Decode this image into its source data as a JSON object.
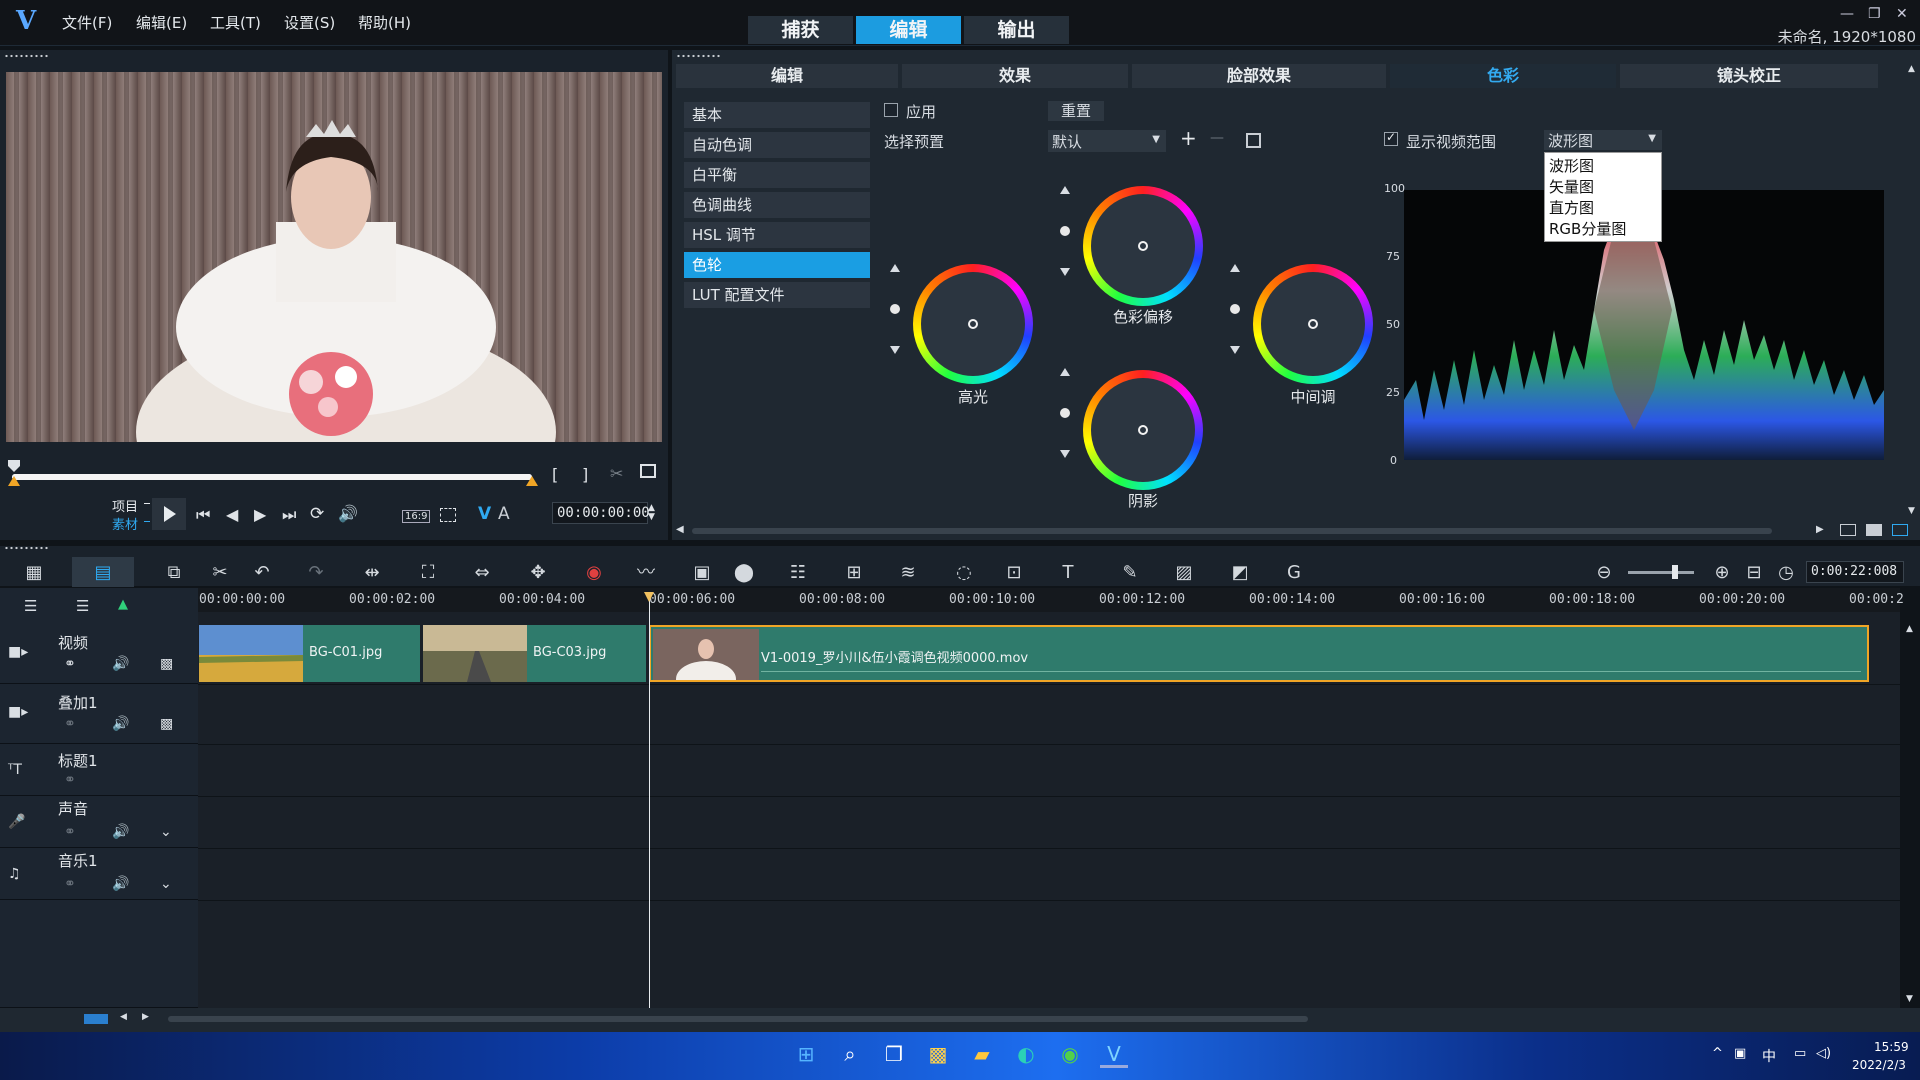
{
  "app": {
    "logo_letter": "V",
    "menu": [
      "文件(F)",
      "编辑(E)",
      "工具(T)",
      "设置(S)",
      "帮助(H)"
    ],
    "modes": [
      "捕获",
      "编辑",
      "输出"
    ],
    "active_mode": 1,
    "project_info": "未命名, 1920*1080",
    "window_controls": [
      "—",
      "❐",
      "✕"
    ]
  },
  "preview": {
    "mode_project": "项目",
    "mode_clip": "素材",
    "aspect": "16:9",
    "v_label": "V",
    "a_label": "A",
    "timecode": "00:00:00:00",
    "scrub_progress": 1.0
  },
  "options_panel": {
    "tabs": [
      "编辑",
      "效果",
      "脸部效果",
      "色彩",
      "镜头校正"
    ],
    "active_tab": 3,
    "categories": [
      "基本",
      "自动色调",
      "白平衡",
      "色调曲线",
      "HSL 调节",
      "色轮",
      "LUT 配置文件"
    ],
    "active_category": 5,
    "apply_label": "应用",
    "reset_label": "重置",
    "preset_label": "选择预置",
    "preset_value": "默认",
    "add_symbol": "+",
    "remove_symbol": "—",
    "wheels": {
      "highlight": "高光",
      "offset": "色彩偏移",
      "midtone": "中间调",
      "shadow": "阴影"
    },
    "scope": {
      "show_label": "显示视频范围",
      "show_checked": true,
      "selected": "波形图",
      "options": [
        "波形图",
        "矢量图",
        "直方图",
        "RGB分量图"
      ],
      "ticks": [
        "100",
        "75",
        "50",
        "25",
        "0"
      ]
    }
  },
  "timeline": {
    "current_time": "0:00:22:008",
    "ruler": [
      "00:00:00:00",
      "00:00:02:00",
      "00:00:04:00",
      "00:00:06:00",
      "00:00:08:00",
      "00:00:10:00",
      "00:00:12:00",
      "00:00:14:00",
      "00:00:16:00",
      "00:00:18:00",
      "00:00:20:00",
      "00:00:2"
    ],
    "tracks": [
      "视频",
      "叠加1",
      "标题1",
      "声音",
      "音乐1"
    ],
    "clips": [
      {
        "name": "BG-C01.jpg"
      },
      {
        "name": "BG-C03.jpg"
      },
      {
        "name": "V1-0019_罗小川&伍小霞调色视频0000.mov"
      }
    ]
  },
  "taskbar": {
    "ime": "中",
    "time": "15:59",
    "date": "2022/2/3"
  },
  "colors": {
    "accent": "#1c9ce0",
    "clip": "#2f7b6c",
    "panel": "#1e2630",
    "background": "#0f1419"
  }
}
